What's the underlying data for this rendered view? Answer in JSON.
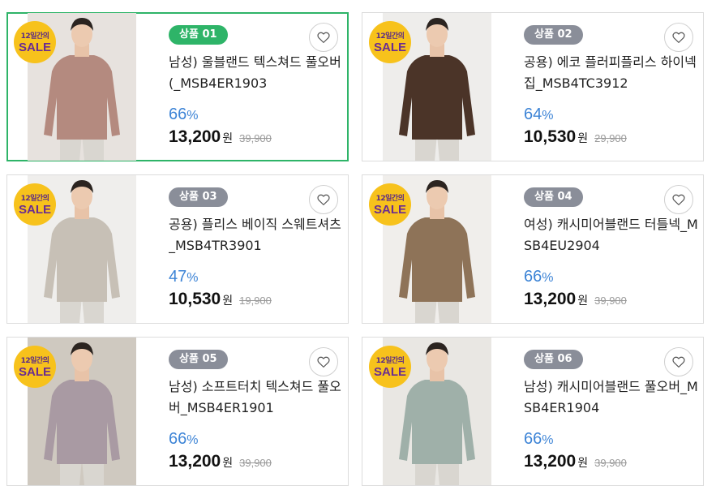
{
  "products": [
    {
      "badge_top": "12일간의",
      "badge_main": "SALE",
      "number_label": "상품 01",
      "title": "남성) 울블랜드 텍스쳐드 풀오버 (_MSB4ER1903",
      "discount": "66",
      "discount_unit": "%",
      "price": "13,200",
      "currency": "원",
      "original_price": "39,900",
      "selected": true,
      "garment_color": "#b48a7f",
      "photo_bg": "#e7e2de"
    },
    {
      "badge_top": "12일간의",
      "badge_main": "SALE",
      "number_label": "상품 02",
      "title": "공용) 에코 플러피플리스 하이넥 집_MSB4TC3912",
      "discount": "64",
      "discount_unit": "%",
      "price": "10,530",
      "currency": "원",
      "original_price": "29,900",
      "selected": false,
      "garment_color": "#4b3428",
      "photo_bg": "#eeedeb"
    },
    {
      "badge_top": "12일간의",
      "badge_main": "SALE",
      "number_label": "상품 03",
      "title": "공용) 플리스 베이직 스웨트셔츠_MSB4TR3901",
      "discount": "47",
      "discount_unit": "%",
      "price": "10,530",
      "currency": "원",
      "original_price": "19,900",
      "selected": false,
      "garment_color": "#c7c0b6",
      "photo_bg": "#efeeec"
    },
    {
      "badge_top": "12일간의",
      "badge_main": "SALE",
      "number_label": "상품 04",
      "title": "여성) 캐시미어블랜드 터틀넥_MSB4EU2904",
      "discount": "66",
      "discount_unit": "%",
      "price": "13,200",
      "currency": "원",
      "original_price": "39,900",
      "selected": false,
      "garment_color": "#8e7358",
      "photo_bg": "#f0eeeb"
    },
    {
      "badge_top": "12일간의",
      "badge_main": "SALE",
      "number_label": "상품 05",
      "title": "남성) 소프트터치 텍스쳐드 풀오버_MSB4ER1901",
      "discount": "66",
      "discount_unit": "%",
      "price": "13,200",
      "currency": "원",
      "original_price": "39,900",
      "selected": false,
      "garment_color": "#a99aa3",
      "photo_bg": "#cfc9c0"
    },
    {
      "badge_top": "12일간의",
      "badge_main": "SALE",
      "number_label": "상품 06",
      "title": "남성) 캐시미어블랜드 풀오버_MSB4ER1904",
      "discount": "66",
      "discount_unit": "%",
      "price": "13,200",
      "currency": "원",
      "original_price": "39,900",
      "selected": false,
      "garment_color": "#9fb0a9",
      "photo_bg": "#e9e7e3"
    }
  ],
  "colors": {
    "active_green": "#2eb468",
    "pill_gray": "#8a8e99",
    "discount_blue": "#3d84d6",
    "badge_yellow": "#f7c21c",
    "badge_purple": "#6a2c91"
  },
  "icons": {
    "wishlist": "heart-outline-icon"
  }
}
